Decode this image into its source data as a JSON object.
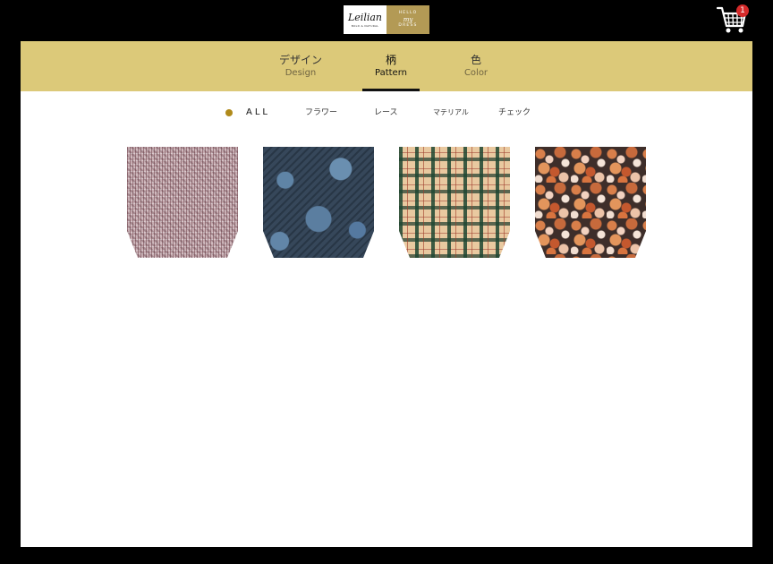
{
  "header": {
    "brand": {
      "left_script": "Leilian",
      "left_sub": "BOLD & NATURAL",
      "right_line1": "HELLO",
      "right_line2": "my",
      "right_line3": "DRESS"
    },
    "cart": {
      "icon": "cart-icon",
      "count": "1",
      "badge_color": "#d42a2a"
    }
  },
  "tabs": [
    {
      "jp": "デザイン",
      "en": "Design",
      "active": false
    },
    {
      "jp": "柄",
      "en": "Pattern",
      "active": true
    },
    {
      "jp": "色",
      "en": "Color",
      "active": false
    }
  ],
  "filters": [
    {
      "label": "ALL",
      "active": true
    },
    {
      "label": "フラワー",
      "active": false
    },
    {
      "label": "レース",
      "active": false
    },
    {
      "label": "マテリアル",
      "active": false
    },
    {
      "label": "チェック",
      "active": false
    }
  ],
  "swatches": [
    {
      "pattern": "tweed"
    },
    {
      "pattern": "lace"
    },
    {
      "pattern": "check"
    },
    {
      "pattern": "floral"
    }
  ],
  "colors": {
    "tab_bar": "#dcc979",
    "active_dot": "#b08a1a",
    "brand_gold": "#b39a55"
  }
}
